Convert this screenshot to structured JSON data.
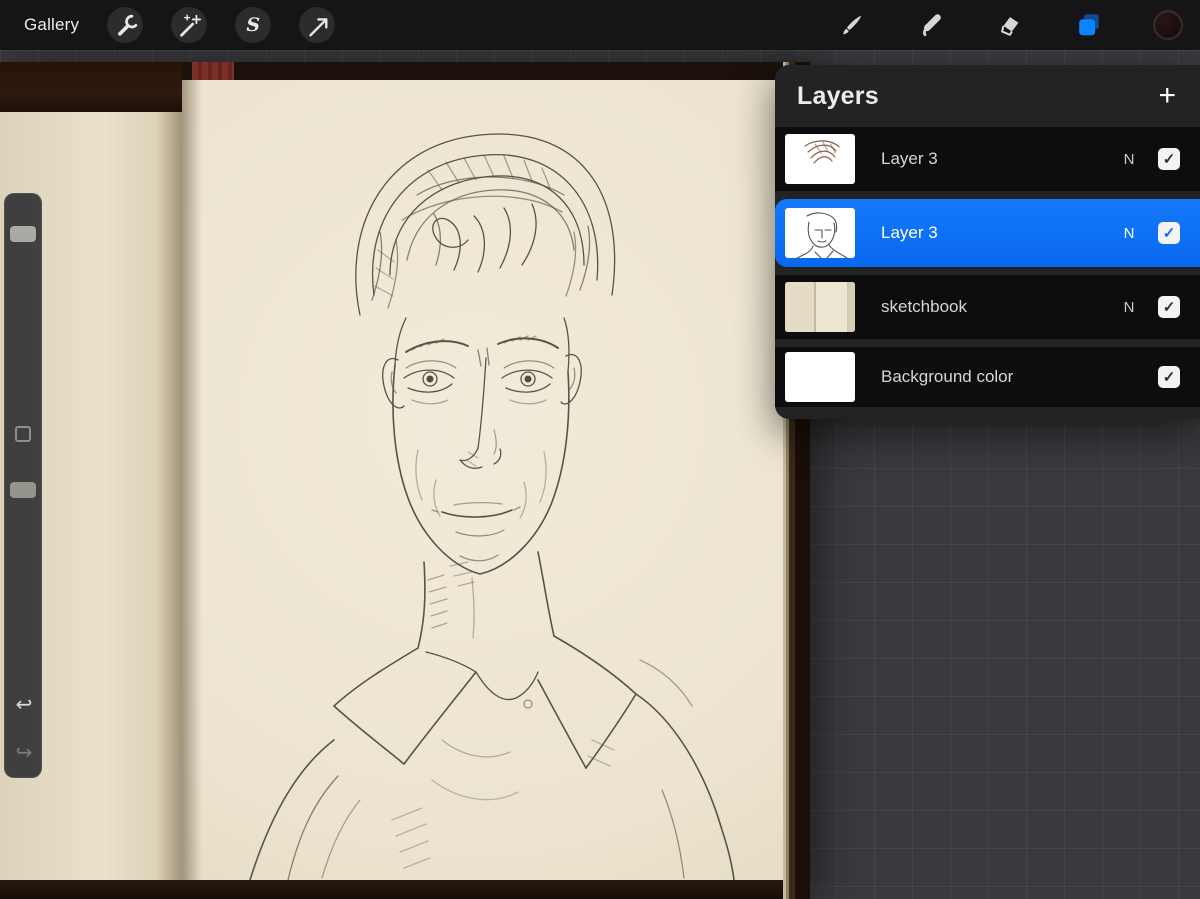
{
  "topbar": {
    "gallery_label": "Gallery",
    "left_tools": [
      {
        "icon": "wrench-icon"
      },
      {
        "icon": "adjustments-magic-wand-icon"
      },
      {
        "icon": "selection-icon"
      },
      {
        "icon": "transform-arrow-icon"
      }
    ],
    "right_tools": [
      {
        "icon": "brush-icon"
      },
      {
        "icon": "smudge-icon"
      },
      {
        "icon": "eraser-icon"
      },
      {
        "icon": "layers-icon",
        "active": true
      },
      {
        "icon": "active-color-swatch"
      }
    ],
    "active_color": "radial-gradient(circle at 35% 30%, #2b1715, #100808)"
  },
  "layers_panel": {
    "title": "Layers",
    "layers": [
      {
        "name": "Layer 3",
        "blend": "N",
        "checked": true,
        "selected": false,
        "thumbnail": "hair-sketch"
      },
      {
        "name": "Layer 3",
        "blend": "N",
        "checked": true,
        "selected": true,
        "thumbnail": "face-sketch"
      },
      {
        "name": "sketchbook",
        "blend": "N",
        "checked": true,
        "selected": false,
        "thumbnail": "paper-photo"
      },
      {
        "name": "Background color",
        "blend": "",
        "checked": true,
        "selected": false,
        "thumbnail": "white"
      }
    ]
  },
  "sidebar": {
    "controls": [
      "brush-size-slider",
      "modify-button",
      "opacity-slider",
      "undo-button",
      "redo-button"
    ]
  },
  "glyphs": {
    "add": "+",
    "check": "✓",
    "undo": "↩",
    "redo": "↪",
    "selection": "S"
  },
  "colors": {
    "accent_blue": "#0a84ff",
    "topbar_bg": "#151517",
    "canvas_grid_bg": "#3a3a3e",
    "panel_bg": "#232325",
    "layer_row_bg": "#0d0d0f",
    "selected_row_bg": "#0d6ff3",
    "paper": "#ece4cf"
  }
}
